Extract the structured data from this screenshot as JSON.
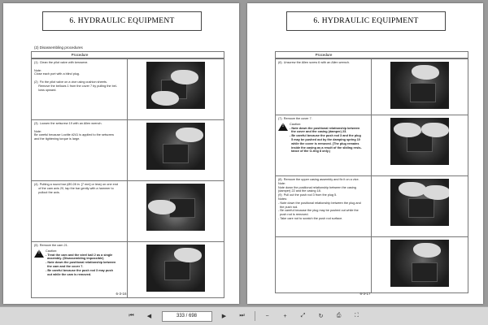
{
  "left_page": {
    "header": "6. HYDRAULIC EQUIPMENT",
    "section": "(2) Disassembling procedures",
    "table_header": "Procedure",
    "steps": [
      {
        "lines": [
          "(1)  Clean the pilot valve with kerosene.",
          "",
          "Note:",
          "Close each port with a blind plug.",
          "",
          "(2)  Fix the pilot valve on a vice using cushion sheets.",
          "     Remove the bellows 1 from the cover 7 by pulling the bel-",
          "     lows upward."
        ]
      },
      {
        "lines": [
          "(3)  Loosen the setscrew 19 with an Allen wrench.",
          "",
          "Note:",
          "Be careful because Loctite #241 is applied to the setscrew",
          "and the tightening torque is large."
        ]
      },
      {
        "lines": [
          "(4)  Putting a round bar (Ø0.28 in. [7 mm] or less) on one end",
          "     of the cam axis 20, tap the bar gently with a hammer to",
          "     pullout the axis."
        ]
      },
      {
        "lines": [
          "(5)  Remove the cam 21."
        ],
        "caution_title": "Caution:",
        "caution": [
          "- Treat the cam and the steel ball 2 as a single",
          "  assembly. (Disassembling impossible)",
          "- Note down the positional relationship between",
          "  the cam and the cover 7.",
          "- Be careful because the push rod 3 may push",
          "  out while the cam is removed."
        ]
      }
    ],
    "page_number": "6-3-16"
  },
  "right_page": {
    "header": "6. HYDRAULIC EQUIPMENT",
    "table_header": "Procedure",
    "steps": [
      {
        "lines": [
          "(6)  Unscrew the Allen screw 6 with an Allen wrench."
        ]
      },
      {
        "lines": [
          "(7)  Remove the cover 7."
        ],
        "caution_title": "Caution:",
        "caution": [
          "- Note down the positional relationship between",
          "  the cover and the casing (damper) 23.",
          "- Be careful because the push rod 3 and the plug",
          "  5 may be pushed out by the damping spring 10",
          "  while the cover is removed. (The plug remains",
          "  inside the casing as a result of the sliding resis-",
          "  tance of the O-ring 8 only.)"
        ]
      },
      {
        "lines": [
          "(8)  Remove the upper casing assembly and fix it on a vice.",
          "Note:",
          "Note down the positional relationship between the casing",
          "(damper) 22 and the casing 18.",
          "(9)  Pull out the push rod 3 from the plug 5.",
          "Notes:",
          "- Note down the positional relationship between the plug and",
          "  the push rod.",
          "- Be careful because the plug may be pushed out while the",
          "  push rod is removed.",
          "- Take care not to scratch the push rod surface."
        ]
      },
      {
        "lines": []
      }
    ],
    "page_number": "6-3-17"
  },
  "toolbar": {
    "page_display": "333 / 698",
    "icons": [
      "first-page-icon",
      "prev-page-icon",
      "next-page-icon",
      "last-page-icon",
      "zoom-out-icon",
      "zoom-in-icon",
      "fit-icon",
      "rotate-icon",
      "print-icon",
      "fullscreen-icon"
    ]
  }
}
